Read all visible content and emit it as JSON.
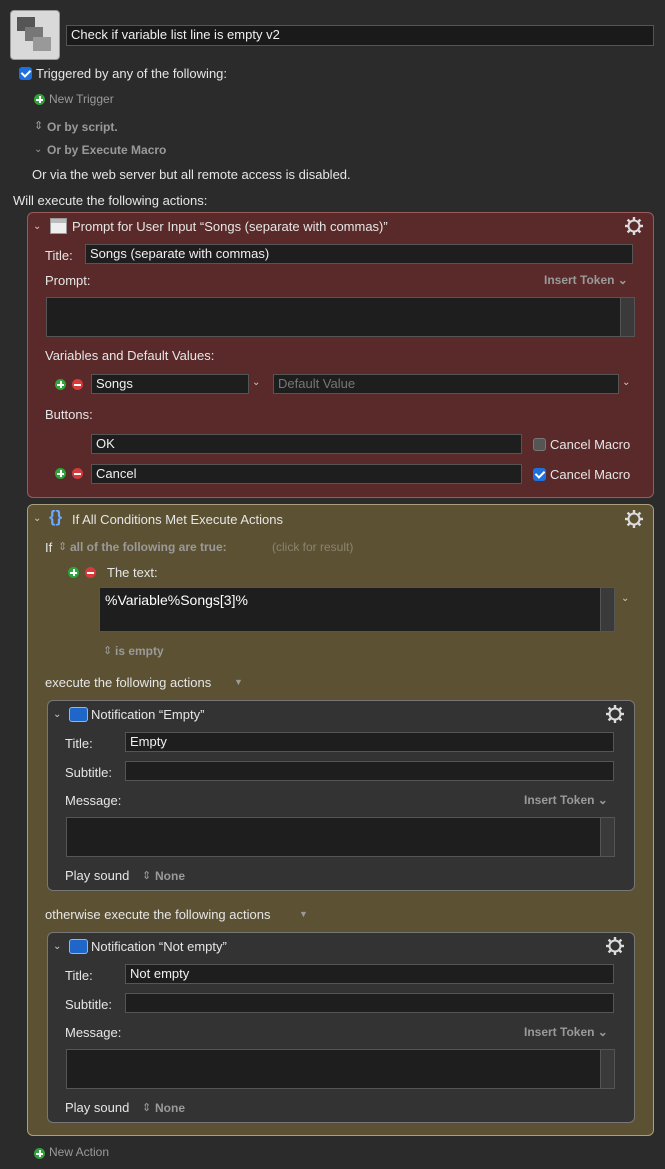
{
  "macro": {
    "name": "Check if variable list line is empty v2",
    "triggered_label": "Triggered by any of the following:",
    "new_trigger": "New Trigger",
    "or_by_script": "Or by script.",
    "or_by_execute_macro": "Or by Execute Macro",
    "web_server_note": "Or via the web server but all remote access is disabled.",
    "will_execute": "Will execute the following actions:",
    "new_action": "New Action"
  },
  "prompt_action": {
    "header": "Prompt for User Input “Songs (separate with commas)”",
    "title_label": "Title:",
    "title_value": "Songs (separate with commas)",
    "prompt_label": "Prompt:",
    "insert_token": "Insert Token",
    "vars_label": "Variables and Default Values:",
    "var_name": "Songs",
    "default_placeholder": "Default Value",
    "buttons_label": "Buttons:",
    "buttons": [
      {
        "label": "OK",
        "cancel_text": "Cancel Macro",
        "cancel_checked": false
      },
      {
        "label": "Cancel",
        "cancel_text": "Cancel Macro",
        "cancel_checked": true
      }
    ]
  },
  "if_action": {
    "header": "If All Conditions Met Execute Actions",
    "if_word": "If",
    "condition_mode": "all of the following are true:",
    "click_result": "(click for result)",
    "the_text_label": "The text:",
    "text_value": "%Variable%Songs[3]%",
    "operator": "is empty",
    "execute_label": "execute the following actions",
    "otherwise_label": "otherwise execute the following actions"
  },
  "notif_empty": {
    "header": "Notification “Empty”",
    "title_label": "Title:",
    "title_value": "Empty",
    "subtitle_label": "Subtitle:",
    "subtitle_value": "",
    "message_label": "Message:",
    "insert_token": "Insert Token",
    "play_sound_label": "Play sound",
    "sound_value": "None"
  },
  "notif_not_empty": {
    "header": "Notification “Not empty”",
    "title_label": "Title:",
    "title_value": "Not empty",
    "subtitle_label": "Subtitle:",
    "subtitle_value": "",
    "message_label": "Message:",
    "insert_token": "Insert Token",
    "play_sound_label": "Play sound",
    "sound_value": "None"
  },
  "colors": {
    "prompt_panel": "#5a2a2a",
    "if_panel": "#5c5132",
    "notification_panel": "#333333",
    "accent_blue": "#1e6fe0"
  },
  "icons": [
    "macro-icon",
    "window-icon",
    "braces-icon",
    "notification-icon",
    "gear-icon",
    "plus-icon",
    "minus-icon",
    "chevron-down-icon",
    "updown-icon"
  ]
}
